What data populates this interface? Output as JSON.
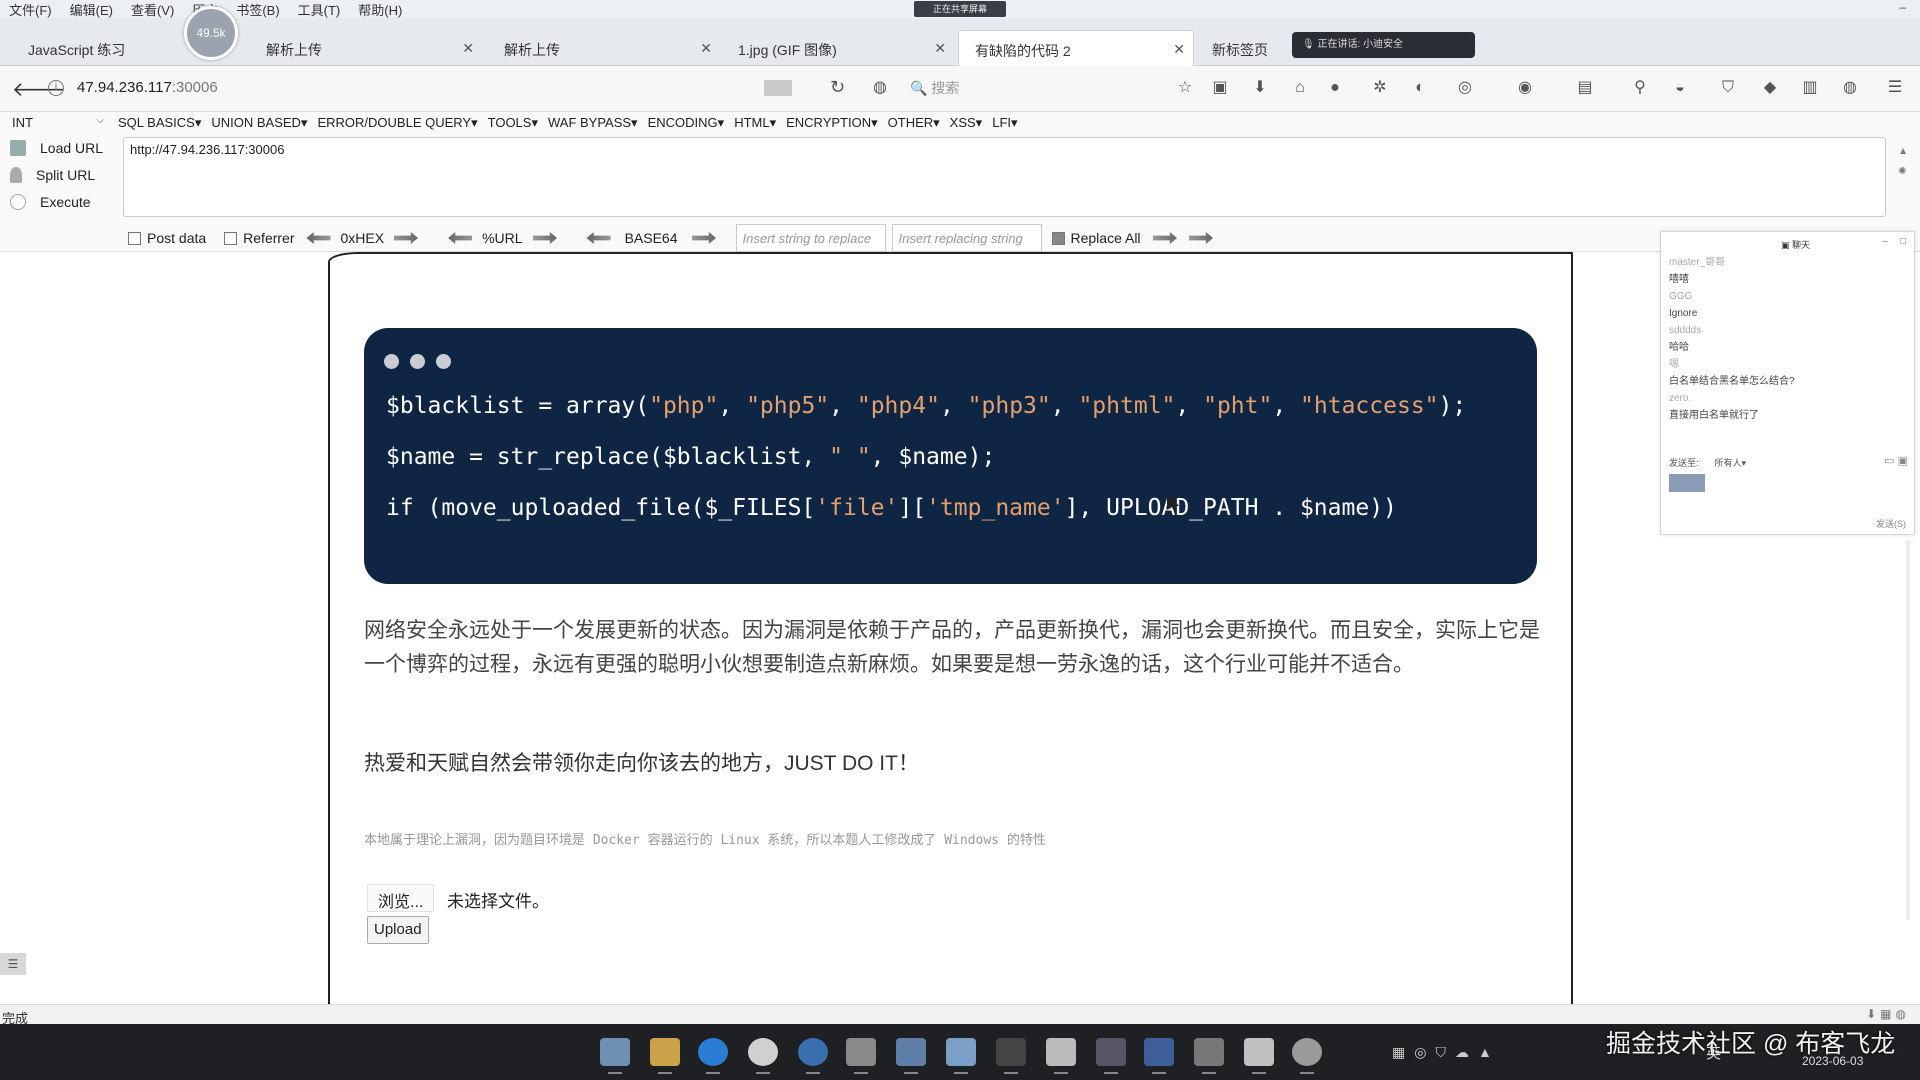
{
  "menubar": {
    "items": [
      "文件(F)",
      "编辑(E)",
      "查看(V)",
      "历史",
      "书签(B)",
      "工具(T)",
      "帮助(H)"
    ],
    "center_tag": "正在共享屏幕"
  },
  "perf_indicator": "49.5k",
  "tabs": [
    {
      "label": "JavaScript 练习"
    },
    {
      "label": "解析上传"
    },
    {
      "label": "解析上传"
    },
    {
      "label": "1.jpg (GIF 图像)"
    },
    {
      "label": "有缺陷的代码 2"
    },
    {
      "label": "新标签页"
    }
  ],
  "recording_pill": "正在讲话: 小迪安全",
  "navbar": {
    "url_host": "47.94.236.117",
    "url_port": ":30006",
    "search_placeholder": "搜索"
  },
  "hackbar": {
    "select_value": "INT",
    "menu": [
      "SQL BASICS▾",
      "UNION BASED▾",
      "ERROR/DOUBLE QUERY▾",
      "TOOLS▾",
      "WAF BYPASS▾",
      "ENCODING▾",
      "HTML▾",
      "ENCRYPTION▾",
      "OTHER▾",
      "XSS▾",
      "LFI▾"
    ],
    "load_url": "Load URL",
    "split_url": "Split URL",
    "execute": "Execute",
    "url_value": "http://47.94.236.117:30006",
    "post_data": "Post data",
    "referrer": "Referrer",
    "hex": "0xHEX",
    "url_enc": "%URL",
    "base64": "BASE64",
    "replace_placeholder": "Insert string to replace",
    "replacing_placeholder": "Insert replacing string",
    "replace_all": "Replace All"
  },
  "code": {
    "line1_var": "$blacklist = ",
    "line1_fn": "array(",
    "line1_strs": [
      "\"php\"",
      "\"php5\"",
      "\"php4\"",
      "\"php3\"",
      "\"phtml\"",
      "\"pht\"",
      "\"htaccess\""
    ],
    "line1_sep": ", ",
    "line1_end": ");",
    "line2_a": "$name = ",
    "line2_fn": "str_replace(",
    "line2_b": "$blacklist, ",
    "line2_str": "\" \"",
    "line2_c": ", $name);",
    "line3_a": "if (",
    "line3_fn": "move_uploaded_file(",
    "line3_b": "$_FILES[",
    "line3_s1": "'file'",
    "line3_c": "][",
    "line3_s2": "'tmp_name'",
    "line3_d": "], UPLOAD_PATH . $name))"
  },
  "content": {
    "para1": "网络安全永远处于一个发展更新的状态。因为漏洞是依赖于产品的，产品更新换代，漏洞也会更新换代。而且安全，实际上它是一个博弈的过程，永远有更强的聪明小伙想要制造点新麻烦。如果要是想一劳永逸的话，这个行业可能并不适合。",
    "para2": "热爱和天赋自然会带领你走向你该去的地方，JUST DO IT！",
    "note": "本地属于理论上漏洞，因为题目环境是 Docker 容器运行的 Linux 系统，所以本题人工修改成了 Windows 的特性",
    "browse": "浏览...",
    "no_file": "未选择文件。",
    "upload": "Upload"
  },
  "chat": {
    "title": "聊天",
    "messages": [
      "master_哥哥",
      "嘻嘻",
      "GGG",
      "Ignore",
      "sdddds",
      "哈哈",
      "嗯",
      "白名单结合黑名单怎么结合?",
      "zero.",
      "直接用白名单就行了"
    ],
    "send_to_label": "发送至:",
    "send_to_value": "所有人▾",
    "send_button": "发送(S)"
  },
  "statusbar": {
    "text": "完成"
  },
  "taskbar": {
    "watermark": "掘金技术社区 @ 布客飞龙",
    "date": "2023-06-03",
    "ime": "英"
  },
  "colors": {
    "code_bg": "#0e2544",
    "code_string": "#e2a06e",
    "taskbar_bg": "#1f2023"
  }
}
